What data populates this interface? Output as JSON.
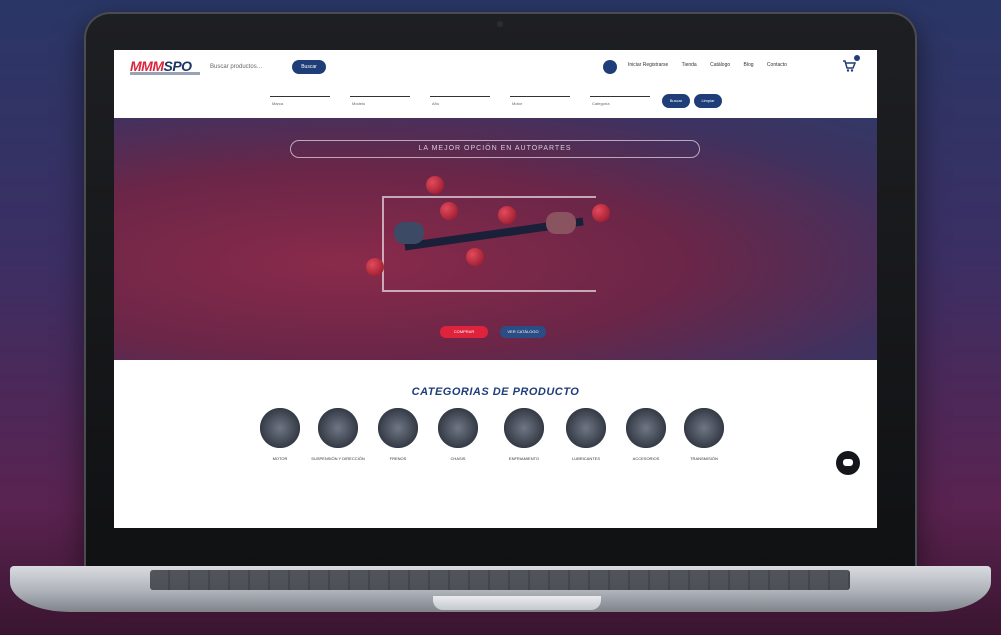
{
  "header": {
    "logo_red": "MMM",
    "logo_blue": "SPO",
    "search_placeholder": "Buscar productos…",
    "search_button": "Buscar",
    "nav": [
      "Iniciar Registrarse",
      "Tienda",
      "Catálogo",
      "Blog",
      "Contacto"
    ],
    "cart_count": ""
  },
  "filters": {
    "fields": [
      "Marca",
      "Modelo",
      "Año",
      "Motor",
      "Categoría"
    ],
    "buttons": [
      "Buscar",
      "Limpiar"
    ]
  },
  "hero": {
    "title": "LA MEJOR OPCIÓN EN AUTOPARTES",
    "btn_primary": "COMPRAR",
    "btn_secondary": "VER CATÁLOGO"
  },
  "categories": {
    "title": "CATEGORIAS DE PRODUCTO",
    "items": [
      "MOTOR",
      "SUSPENSIÓN Y DIRECCIÓN",
      "FRENOS",
      "CHASIS",
      "ENFRIAMIENTO",
      "LUBRICANTES",
      "ACCESORIOS",
      "TRANSMISIÓN"
    ]
  },
  "colors": {
    "primary": "#1f3e79",
    "accent": "#e0233d"
  }
}
